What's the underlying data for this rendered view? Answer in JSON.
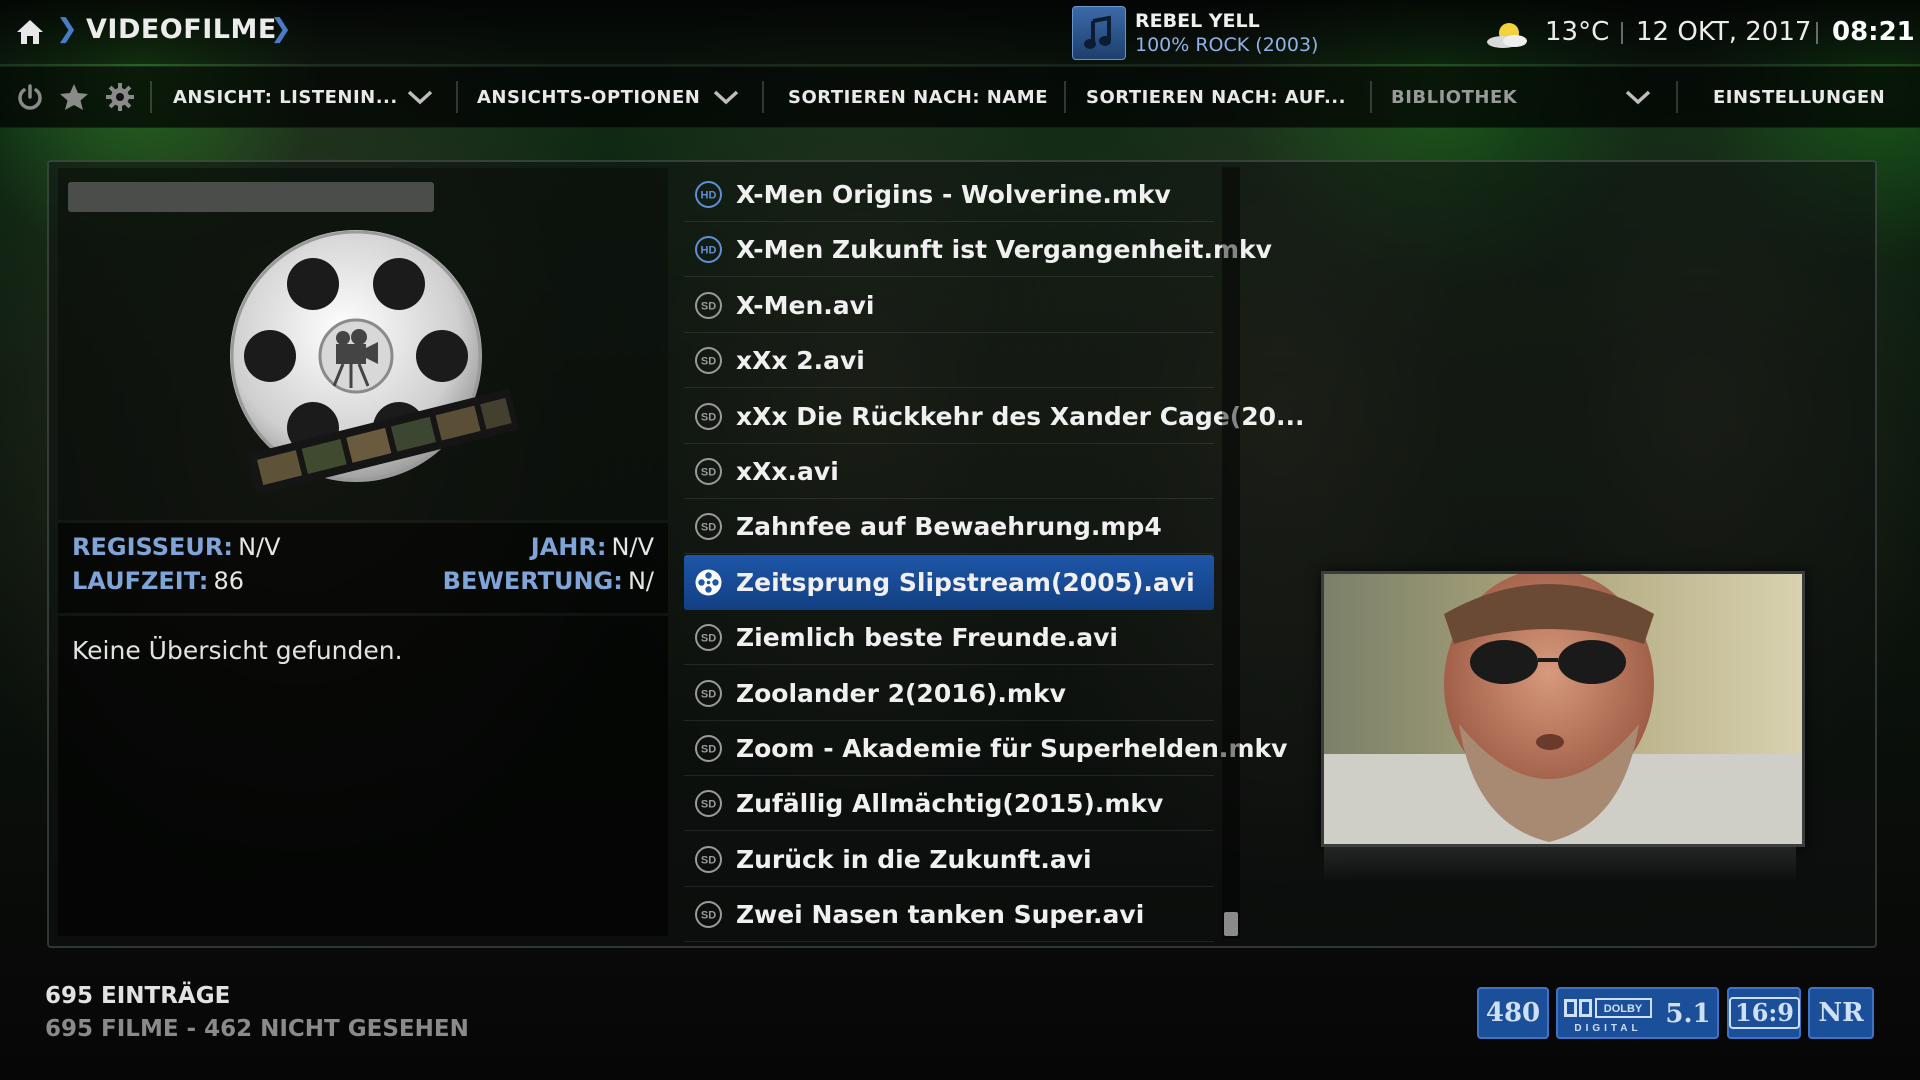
{
  "breadcrumb": {
    "title": "VIDEOFILME"
  },
  "now_playing": {
    "title": "REBEL YELL",
    "subtitle": "100% ROCK (2003)"
  },
  "status": {
    "temperature": "13°C",
    "date": "12 OKT, 2017",
    "time": "08:21"
  },
  "toolbar": {
    "view": "ANSICHT: LISTENIN...",
    "view_options": "ANSICHTS-OPTIONEN",
    "sort_by": "SORTIEREN NACH: NAME",
    "sort_order": "SORTIEREN NACH: AUF...",
    "library": "BIBLIOTHEK",
    "settings": "EINSTELLUNGEN"
  },
  "info": {
    "director_label": "REGISSEUR:",
    "director_value": "N/V",
    "year_label": "JAHR:",
    "year_value": "N/V",
    "runtime_label": "LAUFZEIT:",
    "runtime_value": "86",
    "rating_label": "BEWERTUNG:",
    "rating_value": "N/",
    "plot": "Keine Übersicht gefunden."
  },
  "list": {
    "items": [
      {
        "label": "X-Men Origins - Wolverine.mkv",
        "quality": "HD"
      },
      {
        "label": "X-Men Zukunft ist Vergangenheit.mkv",
        "quality": "HD"
      },
      {
        "label": "X-Men.avi",
        "quality": "SD"
      },
      {
        "label": "xXx 2.avi",
        "quality": "SD"
      },
      {
        "label": "xXx Die Rückkehr des Xander Cage(20...",
        "quality": "SD"
      },
      {
        "label": "xXx.avi",
        "quality": "SD"
      },
      {
        "label": "Zahnfee auf Bewaehrung.mp4",
        "quality": "SD"
      },
      {
        "label": "Zeitsprung Slipstream(2005).avi",
        "quality": "selected"
      },
      {
        "label": "Ziemlich beste Freunde.avi",
        "quality": "SD"
      },
      {
        "label": "Zoolander 2(2016).mkv",
        "quality": "SD"
      },
      {
        "label": "Zoom - Akademie für Superhelden.mkv",
        "quality": "SD"
      },
      {
        "label": "Zufällig Allmächtig(2015).mkv",
        "quality": "SD"
      },
      {
        "label": "Zurück in die Zukunft.avi",
        "quality": "SD"
      },
      {
        "label": "Zwei Nasen tanken Super.avi",
        "quality": "SD"
      }
    ],
    "selected_index": 7
  },
  "footer": {
    "count": "695 EINTRÄGE",
    "summary": "695 FILME  -  462 NICHT GESEHEN"
  },
  "badges": {
    "resolution": "480",
    "audio_brand": "DOLBY",
    "audio_sub": "DIGITAL",
    "channels": "5.1",
    "aspect": "16:9",
    "rating": "NR"
  },
  "colors": {
    "accent": "#1e56a8",
    "label_blue": "#7ea4d8"
  }
}
